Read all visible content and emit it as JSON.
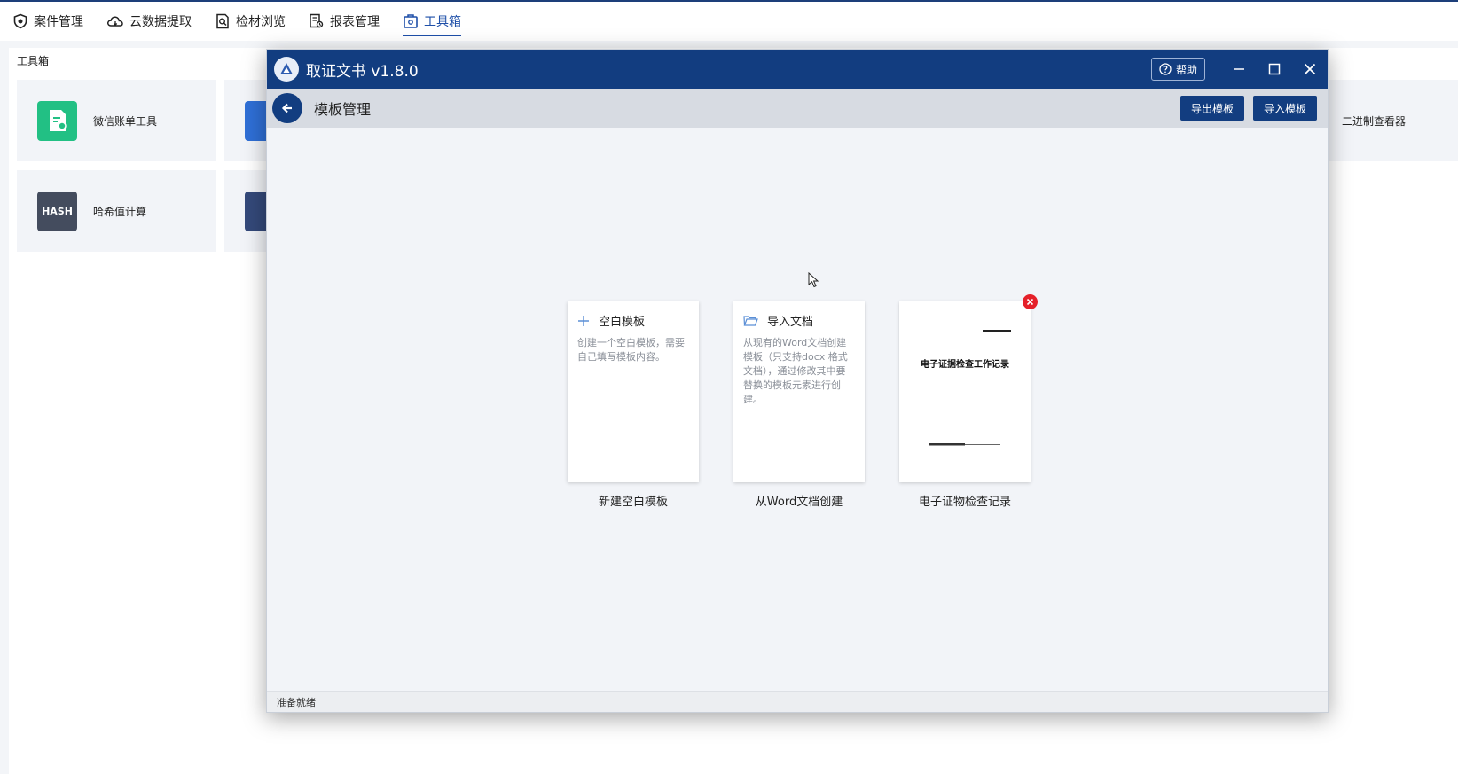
{
  "nav": {
    "items": [
      {
        "label": "案件管理",
        "icon": "shield-icon"
      },
      {
        "label": "云数据提取",
        "icon": "cloud-icon"
      },
      {
        "label": "检材浏览",
        "icon": "document-search-icon"
      },
      {
        "label": "报表管理",
        "icon": "report-icon"
      },
      {
        "label": "工具箱",
        "icon": "toolbox-icon",
        "active": true
      }
    ]
  },
  "toolbox": {
    "section_title": "工具箱",
    "tools": [
      {
        "label": "微信账单工具",
        "icon": "bill-icon",
        "color": "#22c084"
      },
      {
        "label": "哈希值计算",
        "icon_text": "HASH",
        "color": "#444c5e"
      },
      {
        "label": "二进制查看器"
      }
    ]
  },
  "dialog": {
    "app_title": "取证文书 v1.8.0",
    "help_label": "帮助",
    "subtitle": "模板管理",
    "export_label": "导出模板",
    "import_label": "导入模板",
    "templates": [
      {
        "head": "空白模板",
        "icon": "plus-icon",
        "desc": "创建一个空白模板，需要自己填写模板内容。",
        "caption": "新建空白模板"
      },
      {
        "head": "导入文档",
        "icon": "folder-open-icon",
        "desc": "从现有的Word文档创建模板（只支持docx 格式文档），通过修改其中要替换的模板元素进行创建。",
        "caption": "从Word文档创建"
      },
      {
        "doc_title": "电子证据检查工作记录",
        "caption": "电子证物检查记录"
      }
    ],
    "status": "准备就绪"
  },
  "colors": {
    "primary": "#123d80",
    "accent": "#1e4fa8",
    "delete": "#e5202a"
  }
}
